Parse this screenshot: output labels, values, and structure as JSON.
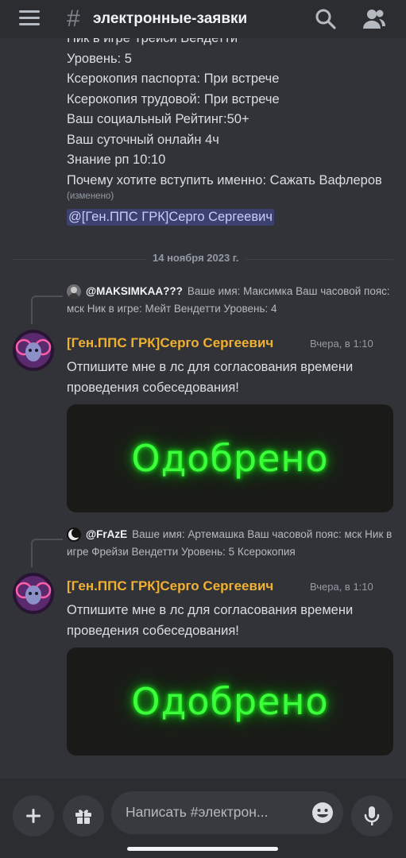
{
  "header": {
    "hash": "#",
    "channel_name": "электронные-заявки"
  },
  "previous_message": {
    "lines": [
      "Ник в игре Трейси Вендетти",
      "Уровень: 5",
      "Ксерокопия паспорта: При встрече",
      "Ксерокопия трудовой: При встрече",
      "Ваш социальный Рейтинг:50+",
      "Ваш суточный онлайн 4ч",
      "Знание рп 10:10",
      "Почему хотите вступить именно: Сажать Вафлеров"
    ],
    "edited": "(изменено)",
    "mention": "@[Ген.ППС ГРК]Серго Сергеевич"
  },
  "date_divider": "14 ноября 2023 г.",
  "messages": [
    {
      "reply_author": "@MAKSIMKAA???",
      "reply_preview": "Ваше имя: Максимка Ваш часовой пояс:   мск Ник в игре: Мейт Вендетти Уровень: 4",
      "author": "[Ген.ППС ГРК]Серго Сергеевич",
      "timestamp": "Вчера, в 1:10",
      "text": "Отпишите мне в лс для согласования времени проведения собеседования!",
      "image_text": "Одобрено"
    },
    {
      "reply_author": "@FrAzE",
      "reply_preview": "Ваше имя: Артемашка Ваш часовой пояс: мск Ник в игре Фрейзи Вендетти Уровень: 5 Ксерокопия",
      "author": "[Ген.ППС ГРК]Серго Сергеевич",
      "timestamp": "Вчера, в 1:10",
      "text": "Отпишите мне в лс для согласования времени проведения собеседования!",
      "image_text": "Одобрено"
    }
  ],
  "composer": {
    "placeholder": "Написать #электрон..."
  },
  "colors": {
    "background": "#313338",
    "bar": "#2b2d31",
    "author": "#f0b132",
    "approved_glow": "#3cff3c"
  }
}
